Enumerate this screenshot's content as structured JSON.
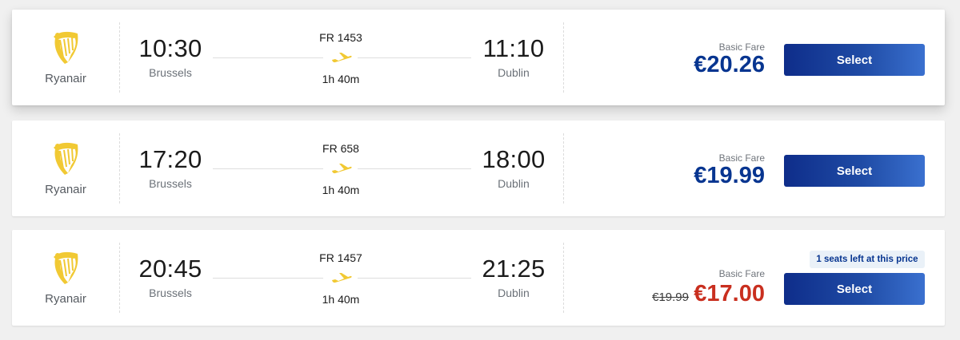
{
  "colors": {
    "background": "#f0f0f0",
    "brand_blue": "#073590",
    "button_gradient": [
      "#0e2d8a",
      "#3a70cf"
    ],
    "logo_yellow": "#f1c933",
    "sale_red": "#c92f1f",
    "badge_bg": "#eaf1f8"
  },
  "flights": [
    {
      "airline": "Ryanair",
      "logo_icon": "ryanair-harp-icon",
      "departure_time": "10:30",
      "departure_city": "Brussels",
      "flight_number": "FR 1453",
      "duration": "1h 40m",
      "arrival_time": "11:10",
      "arrival_city": "Dublin",
      "fare_label": "Basic Fare",
      "price": "€20.26",
      "old_price": "",
      "seats_badge": "",
      "select_label": "Select"
    },
    {
      "airline": "Ryanair",
      "logo_icon": "ryanair-harp-icon",
      "departure_time": "17:20",
      "departure_city": "Brussels",
      "flight_number": "FR 658",
      "duration": "1h 40m",
      "arrival_time": "18:00",
      "arrival_city": "Dublin",
      "fare_label": "Basic Fare",
      "price": "€19.99",
      "old_price": "",
      "seats_badge": "",
      "select_label": "Select"
    },
    {
      "airline": "Ryanair",
      "logo_icon": "ryanair-harp-icon",
      "departure_time": "20:45",
      "departure_city": "Brussels",
      "flight_number": "FR 1457",
      "duration": "1h 40m",
      "arrival_time": "21:25",
      "arrival_city": "Dublin",
      "fare_label": "Basic Fare",
      "price": "€17.00",
      "old_price": "€19.99",
      "seats_badge": "1 seats left at this price",
      "select_label": "Select"
    }
  ]
}
